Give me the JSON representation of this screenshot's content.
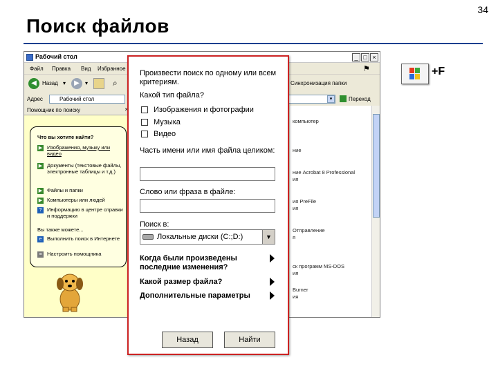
{
  "slide": {
    "number": "34",
    "title": "Поиск файлов"
  },
  "shortcut": {
    "key_icon": "windows-logo-key-icon",
    "text": "+F"
  },
  "explorer": {
    "title": "Рабочий стол",
    "menu": [
      "Файл",
      "Правка",
      "Вид",
      "Избранное"
    ],
    "toolbar": {
      "back_label": "Назад",
      "sync_label": "Синхронизация папки"
    },
    "address": {
      "label": "Адрес",
      "value": "Рабочий стол",
      "go_label": "Переход"
    },
    "search_pane": {
      "header": "Помощник по поиску",
      "question": "Что вы хотите найти?",
      "options": [
        "Изображения, музыку или видео",
        "Документы (текстовые файлы, электронные таблицы и т.д.)",
        "Файлы и папки",
        "Компьютеры или людей",
        "Информацию в центре справки и поддержки"
      ],
      "also": "Вы также можете...",
      "more_options": [
        "Выполнить поиск в Интернете",
        "Настроить помощника"
      ]
    },
    "list_items": [
      "компьютер",
      "ние",
      "ние Acrobat 8 Professional",
      "ия",
      "ия PreFile",
      "ия",
      "Отправление",
      "я",
      "ск программ MS-DOS",
      "ия",
      "Burner",
      "ия"
    ]
  },
  "search_panel": {
    "heading": "Произвести поиск по одному или всем критериям.",
    "file_type_question": "Какой тип файла?",
    "file_types": [
      "Изображения и фотографии",
      "Музыка",
      "Видео"
    ],
    "name_label": "Часть имени или имя файла целиком:",
    "name_value": "",
    "phrase_label": "Слово или фраза в файле:",
    "phrase_value": "",
    "look_in_label": "Поиск в:",
    "look_in_value": "Локальные диски (C:;D:)",
    "expanders": [
      "Когда были произведены последние изменения?",
      "Какой размер файла?",
      "Дополнительные параметры"
    ],
    "back_button": "Назад",
    "find_button": "Найти"
  }
}
